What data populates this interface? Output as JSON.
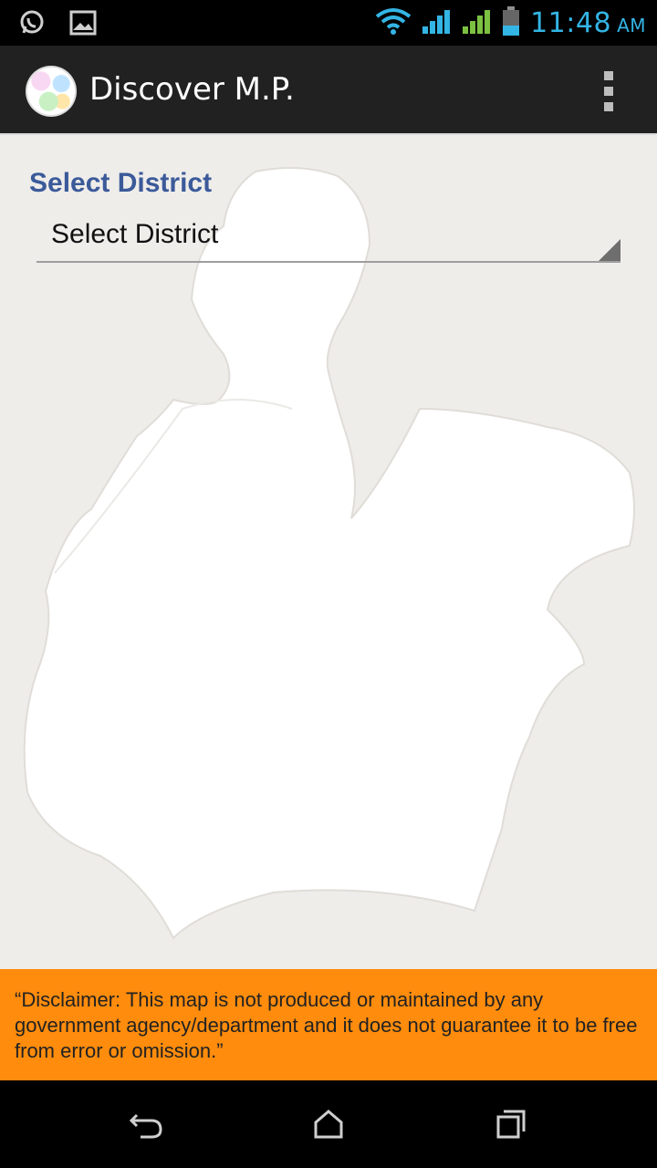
{
  "status_bar": {
    "time": "11:48",
    "ampm": "AM",
    "icons": [
      "whatsapp-icon",
      "gallery-icon",
      "wifi-icon",
      "signal-icon",
      "signal-icon-2",
      "battery-icon"
    ]
  },
  "action_bar": {
    "title": "Discover M.P."
  },
  "form": {
    "label": "Select District",
    "spinner_value": "Select District"
  },
  "disclaimer": {
    "text": "“Disclaimer: This map is not produced or maintained by any government agency/department and it does not guarantee it to be free from error or omission.”"
  },
  "colors": {
    "accent": "#33b5e5",
    "action_bar": "#212121",
    "label": "#3b5a9a",
    "disclaimer_bg": "#ff8c0d",
    "map_bg": "#efedea"
  }
}
